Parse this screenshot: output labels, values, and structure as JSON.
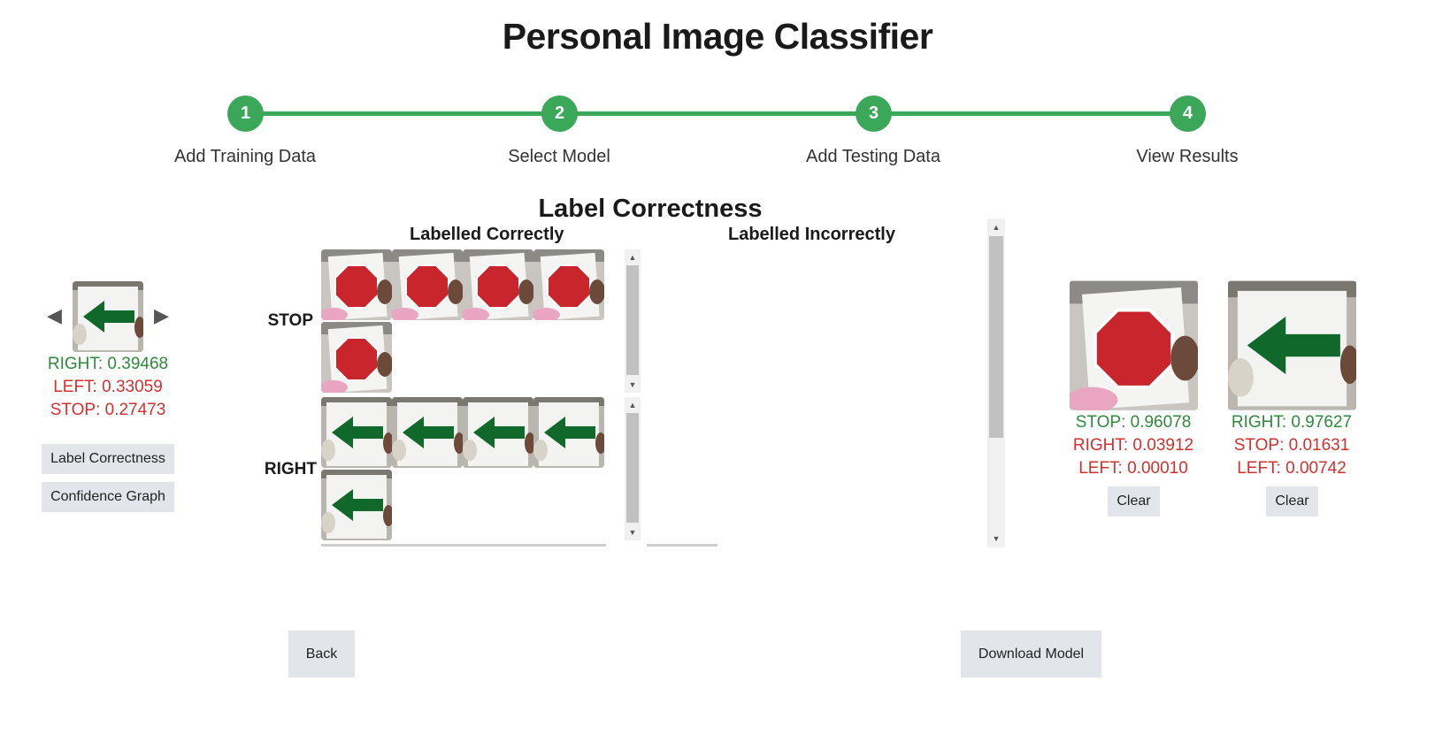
{
  "app": {
    "title": "Personal Image Classifier"
  },
  "stepper": {
    "steps": [
      {
        "number": "1",
        "label": "Add Training Data"
      },
      {
        "number": "2",
        "label": "Select Model"
      },
      {
        "number": "3",
        "label": "Add Testing Data"
      },
      {
        "number": "4",
        "label": "View Results"
      }
    ],
    "color": "#3aa759"
  },
  "correctness": {
    "title": "Label Correctness",
    "correct_header": "Labelled Correctly",
    "incorrect_header": "Labelled Incorrectly",
    "rows": [
      {
        "label": "STOP",
        "images": [
          "stop",
          "stop",
          "stop",
          "stop",
          "stop"
        ]
      },
      {
        "label": "RIGHT",
        "images": [
          "arrow",
          "arrow",
          "arrow",
          "arrow",
          "arrow"
        ]
      }
    ]
  },
  "left_panel": {
    "prev_icon": "triangle-left",
    "next_icon": "triangle-right",
    "scores": [
      {
        "text": "RIGHT: 0.39468",
        "status": "top"
      },
      {
        "text": "LEFT: 0.33059",
        "status": "other"
      },
      {
        "text": "STOP: 0.27473",
        "status": "other"
      }
    ],
    "label_correctness_button": "Label Correctness",
    "confidence_graph_button": "Confidence Graph"
  },
  "right_panels": [
    {
      "image": "stop",
      "scores": [
        {
          "text": "STOP: 0.96078",
          "status": "top"
        },
        {
          "text": "RIGHT: 0.03912",
          "status": "other"
        },
        {
          "text": "LEFT: 0.00010",
          "status": "other"
        }
      ],
      "clear_label": "Clear"
    },
    {
      "image": "arrow",
      "scores": [
        {
          "text": "RIGHT: 0.97627",
          "status": "top"
        },
        {
          "text": "STOP: 0.01631",
          "status": "other"
        },
        {
          "text": "LEFT: 0.00742",
          "status": "other"
        }
      ],
      "clear_label": "Clear"
    }
  ],
  "footer": {
    "back_label": "Back",
    "download_label": "Download Model"
  },
  "colors": {
    "top_score": "#2e8b3c",
    "other_score": "#d33030",
    "button_bg": "#e2e6ea"
  }
}
